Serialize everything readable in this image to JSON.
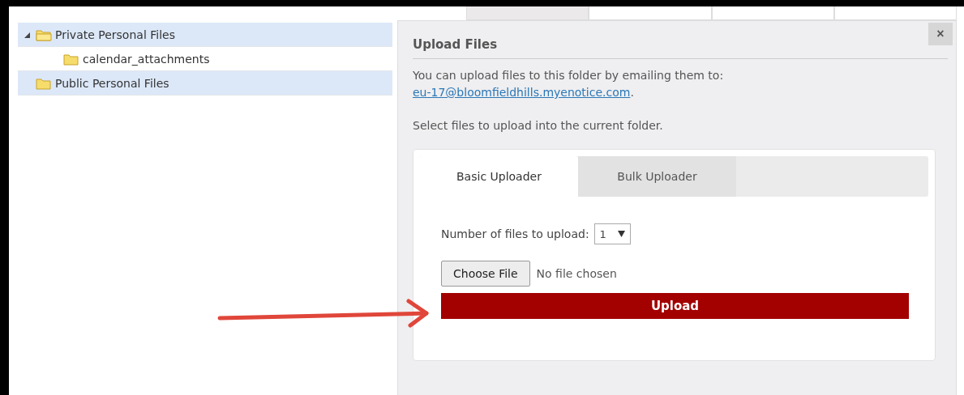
{
  "tree": [
    {
      "label": "Private Personal Files",
      "selected": true,
      "expanded": true,
      "children": [
        {
          "label": "calendar_attachments",
          "selected": false
        }
      ]
    },
    {
      "label": "Public Personal Files",
      "selected": true
    }
  ],
  "top_tabs": [
    {
      "selected": true
    },
    {
      "selected": false
    },
    {
      "selected": false
    },
    {
      "selected": false
    }
  ],
  "dialog": {
    "title": "Upload Files",
    "close": "×",
    "intro": "You can upload files to this folder by emailing them to:",
    "email": "eu-17@bloomfieldhills.myenotice.com",
    "email_end": ".",
    "hint": "Select files to upload into the current folder.",
    "tabs": [
      {
        "label": "Basic Uploader",
        "selected": true
      },
      {
        "label": "Bulk Uploader",
        "selected": false
      }
    ],
    "count_label": "Number of files to upload:",
    "count_value": "1",
    "choose_button": "Choose File",
    "file_status": "No file chosen",
    "upload_button": "Upload"
  }
}
